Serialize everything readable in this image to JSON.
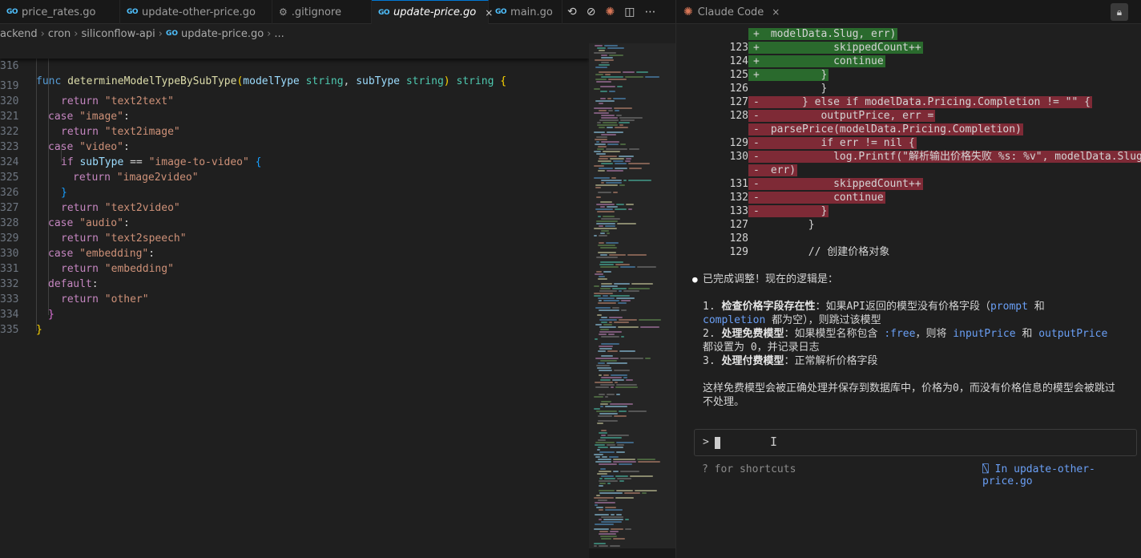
{
  "tabs": [
    {
      "label": "price_rates.go",
      "type": "go"
    },
    {
      "label": "update-other-price.go",
      "type": "go"
    },
    {
      "label": ".gitignore",
      "type": "gear"
    },
    {
      "label": "update-price.go",
      "type": "go",
      "active": true
    },
    {
      "label": "main.go",
      "type": "go"
    }
  ],
  "tab_close": "×",
  "breadcrumb": [
    "ackend",
    "cron",
    "siliconflow-api",
    "update-price.go",
    "..."
  ],
  "editor": {
    "sticky": {
      "ln": "316",
      "func_kw": "func",
      "name": "determineModelTypeBySubType",
      "p1": "modelType",
      "t1": "string",
      "p2": "subType",
      "t2": "string",
      "ret": "string"
    },
    "lines": [
      {
        "ln": "319",
        "c1": "return",
        "c2": "\"text2text\""
      },
      {
        "ln": "320",
        "c1": "case",
        "c2": "\"image\"",
        "c3": ":"
      },
      {
        "ln": "321",
        "c1": "return",
        "c2": "\"text2image\""
      },
      {
        "ln": "322",
        "c1": "case",
        "c2": "\"video\"",
        "c3": ":"
      },
      {
        "ln": "323",
        "c1": "if",
        "c2": "subType",
        "c3": "==",
        "c4": "\"image-to-video\"",
        "c5": "{"
      },
      {
        "ln": "324",
        "c1": "return",
        "c2": "\"image2video\""
      },
      {
        "ln": "325",
        "c1": "}"
      },
      {
        "ln": "326",
        "c1": "return",
        "c2": "\"text2video\""
      },
      {
        "ln": "327",
        "c1": "case",
        "c2": "\"audio\"",
        "c3": ":"
      },
      {
        "ln": "328",
        "c1": "return",
        "c2": "\"text2speech\""
      },
      {
        "ln": "329",
        "c1": "case",
        "c2": "\"embedding\"",
        "c3": ":"
      },
      {
        "ln": "330",
        "c1": "return",
        "c2": "\"embedding\""
      },
      {
        "ln": "331",
        "c1": "default",
        "c2": ":"
      },
      {
        "ln": "332",
        "c1": "return",
        "c2": "\"other\""
      },
      {
        "ln": "333",
        "c1": "}"
      },
      {
        "ln": "334",
        "c1": "}"
      },
      {
        "ln": "335"
      }
    ]
  },
  "right_tab": {
    "label": "Claude Code"
  },
  "diff": [
    {
      "num": "",
      "sign": "+",
      "text": " modelData.Slug, err)",
      "kind": "add"
    },
    {
      "num": "123",
      "sign": "+",
      "text": "           skippedCount++",
      "kind": "add"
    },
    {
      "num": "124",
      "sign": "+",
      "text": "           continue",
      "kind": "add"
    },
    {
      "num": "125",
      "sign": "+",
      "text": "         }",
      "kind": "add"
    },
    {
      "num": "126",
      "sign": "",
      "text": "         }",
      "kind": "plain"
    },
    {
      "num": "127",
      "sign": "-",
      "text": "      } else if modelData.Pricing.Completion != \"\" {",
      "kind": "del"
    },
    {
      "num": "128",
      "sign": "-",
      "text": "         outputPrice, err =",
      "kind": "del"
    },
    {
      "num": "",
      "sign": "-",
      "text": " parsePrice(modelData.Pricing.Completion)",
      "kind": "del"
    },
    {
      "num": "129",
      "sign": "-",
      "text": "         if err != nil {",
      "kind": "del"
    },
    {
      "num": "130",
      "sign": "-",
      "text": "           log.Printf(\"解析输出价格失败 %s: %v\", modelData.Slug,",
      "kind": "del"
    },
    {
      "num": "",
      "sign": "-",
      "text": " err)",
      "kind": "del"
    },
    {
      "num": "131",
      "sign": "-",
      "text": "           skippedCount++",
      "kind": "del"
    },
    {
      "num": "132",
      "sign": "-",
      "text": "           continue",
      "kind": "del"
    },
    {
      "num": "133",
      "sign": "-",
      "text": "         }",
      "kind": "del"
    },
    {
      "num": "127",
      "sign": "",
      "text": "       }",
      "kind": "plain"
    },
    {
      "num": "128",
      "sign": "",
      "text": "",
      "kind": "plain"
    },
    {
      "num": "129",
      "sign": "",
      "text": "       // 创建价格对象",
      "kind": "plain"
    }
  ],
  "message": {
    "bullet": "●",
    "intro": "已完成调整！现在的逻辑是：",
    "item1_num": "1.",
    "item1_title": "检查价格字段存在性",
    "item1_text_a": "：如果API返回的模型没有价格字段（",
    "item1_code_a": "prompt",
    "item1_text_b": " 和",
    "item1_code_b": "completion",
    "item1_text_c": " 都为空），则跳过该模型",
    "item2_num": "2.",
    "item2_title": "处理免费模型",
    "item2_text_a": "：如果模型名称包含 ",
    "item2_code_a": ":free",
    "item2_text_b": "，则将 ",
    "item2_code_b": "inputPrice",
    "item2_text_c": " 和 ",
    "item2_code_c": "outputPrice",
    "item2_text_d": "都设置为 ",
    "item2_code_d": "0",
    "item2_text_e": "，并记录日志",
    "item3_num": "3.",
    "item3_title": "处理付费模型",
    "item3_text": "：正常解析价格字段",
    "summary": "这样免费模型会被正确处理并保存到数据库中，价格为0，而没有价格信息的模型会被跳过不处理。"
  },
  "prompt": {
    "chevron": ">"
  },
  "footer": {
    "left": "? for shortcuts",
    "right": "⍂ In update-other-price.go"
  }
}
